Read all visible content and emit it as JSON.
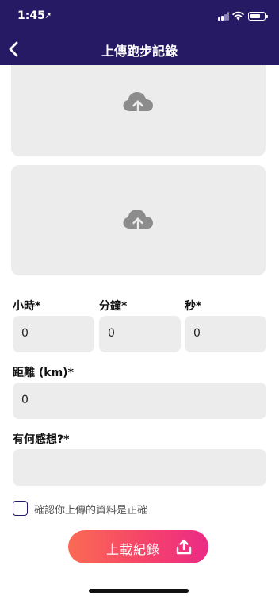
{
  "status_bar": {
    "time": "1:45",
    "location_glyph": "➚"
  },
  "header": {
    "title": "上傳跑步記錄",
    "back_icon": "chevron-left-icon",
    "background": "#251a63"
  },
  "uploads": [
    {
      "icon": "cloud-upload-icon"
    },
    {
      "icon": "cloud-upload-icon"
    }
  ],
  "duration": {
    "hours": {
      "label": "小時*",
      "value": "0"
    },
    "minutes": {
      "label": "分鐘*",
      "value": "0"
    },
    "seconds": {
      "label": "秒*",
      "value": "0"
    }
  },
  "distance": {
    "label": "距離 (km)*",
    "value": "0"
  },
  "feelings": {
    "label": "有何感想?*",
    "value": ""
  },
  "confirm": {
    "label": "確認你上傳的資料是正確",
    "checked": false
  },
  "submit": {
    "label": "上載紀錄",
    "icon": "upload-icon",
    "gradient": [
      "#fb6a54",
      "#ec2a86"
    ]
  }
}
